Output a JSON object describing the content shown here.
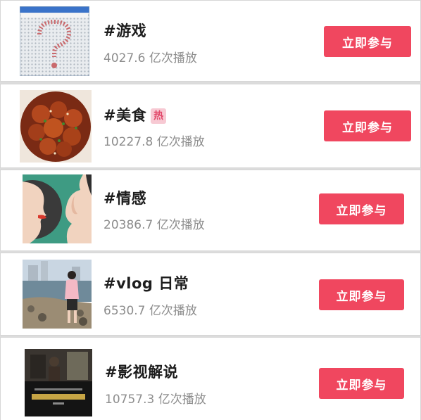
{
  "topics": [
    {
      "title": "#游戏",
      "plays": "4027.6 亿次播放",
      "button": "立即参与",
      "thumb": "minesweeper-question-thumbnail"
    },
    {
      "title": "#美食",
      "badge": "热",
      "plays": "10227.8 亿次播放",
      "button": "立即参与",
      "thumb": "fried-chicken-thumbnail"
    },
    {
      "title": "#情感",
      "plays": "20386.7 亿次播放",
      "button": "立即参与",
      "thumb": "faces-illustration-thumbnail"
    },
    {
      "title": "#vlog 日常",
      "plays": "6530.7 亿次播放",
      "button": "立即参与",
      "thumb": "seaside-girl-photo-thumbnail"
    },
    {
      "title": "#影视解说",
      "plays": "10757.3 亿次播放",
      "button": "立即参与",
      "thumb": "movie-scene-thumbnail"
    }
  ],
  "colors": {
    "button": "#f0475f",
    "badge_bg": "#f7c9d3",
    "badge_text": "#e2486a"
  }
}
